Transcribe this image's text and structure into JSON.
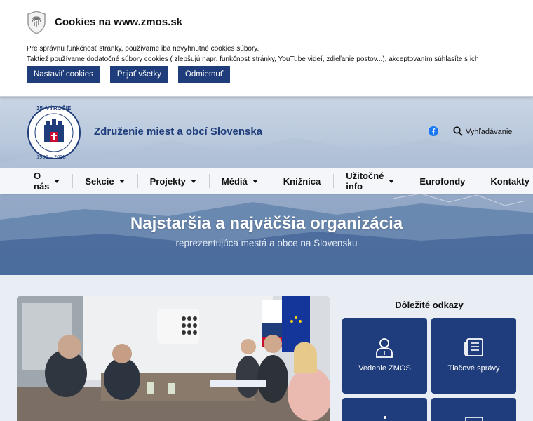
{
  "cookie_banner": {
    "title": "Cookies na www.zmos.sk",
    "line1": "Pre správnu funkčnosť stránky, používame iba nevyhnutné cookies súbory.",
    "line2": "Taktiež používame dodatočné súbory cookies ( zlepšujú napr. funkčnosť stránky, YouTube videí, zdieľanie postov...), akceptovaním súhlasíte s ich používaním.",
    "buttons": [
      "Nastaviť cookies",
      "Prijať všetky",
      "Odmietnuť"
    ]
  },
  "header": {
    "org_name": "Združenie miest a obcí Slovenska",
    "search_label": "Vyhľadávanie",
    "emblem": {
      "top_text": "35. VÝROČIE",
      "years": "1990 – 2025"
    }
  },
  "nav": {
    "items": [
      {
        "label": "O nás",
        "dropdown": true
      },
      {
        "label": "Sekcie",
        "dropdown": true
      },
      {
        "label": "Projekty",
        "dropdown": true
      },
      {
        "label": "Médiá",
        "dropdown": true
      },
      {
        "label": "Knižnica",
        "dropdown": false
      },
      {
        "label": "Užitočné info",
        "dropdown": true
      },
      {
        "label": "Eurofondy",
        "dropdown": false
      },
      {
        "label": "Kontakty",
        "dropdown": false
      }
    ]
  },
  "hero": {
    "title": "Najstaršia a najväčšia organizácia",
    "subtitle": "reprezentujúca mestá a obce na Slovensku"
  },
  "important_links": {
    "title": "Dôležité odkazy",
    "tiles": [
      {
        "label": "Vedenie ZMOS",
        "icon": "person-icon"
      },
      {
        "label": "Tlačové správy",
        "icon": "news-icon"
      }
    ]
  },
  "colors": {
    "brand_blue": "#1e3d7a",
    "tile_blue": "#1f3d7d",
    "facebook": "#1877f2"
  }
}
